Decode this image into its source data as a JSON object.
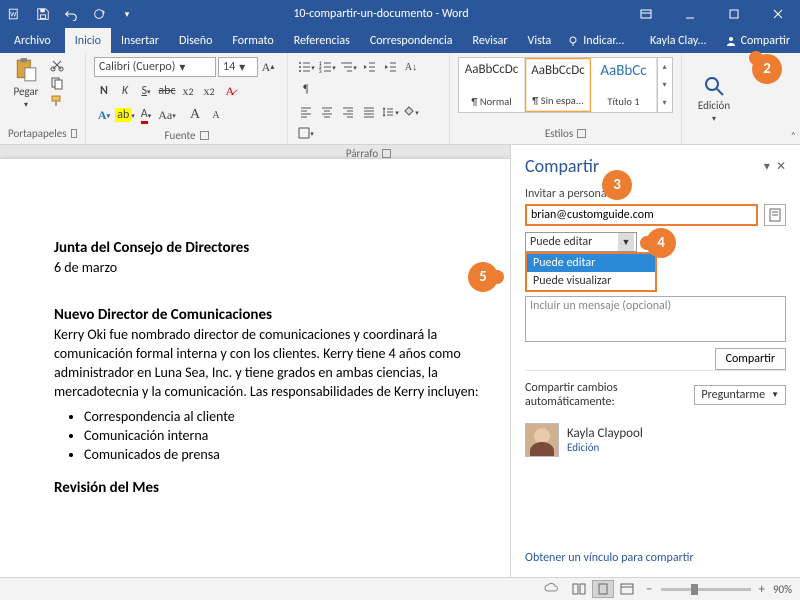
{
  "title": "10-compartir-un-documento - Word",
  "tabs": {
    "file": "Archivo",
    "items": [
      "Inicio",
      "Insertar",
      "Diseño",
      "Formato",
      "Referencias",
      "Correspondencia",
      "Revisar",
      "Vista"
    ],
    "tellme": "Indicar...",
    "account": "Kayla Clay...",
    "share": "Compartir"
  },
  "ribbon": {
    "clipboard": {
      "paste": "Pegar",
      "label": "Portapapeles"
    },
    "font": {
      "name": "Calibri (Cuerpo)",
      "size": "14",
      "label": "Fuente"
    },
    "paragraph": {
      "label": "Párrafo"
    },
    "styles": {
      "label": "Estilos",
      "sample": "AaBbCcDc",
      "sampleH": "AaBbCc",
      "s1": "¶ Normal",
      "s2": "¶ Sin espa...",
      "s3": "Título 1"
    },
    "editing": {
      "label": "Edición"
    }
  },
  "doc": {
    "h1": "Junta del Consejo de Directores",
    "date": "6 de marzo",
    "h2": "Nuevo Director de Comunicaciones",
    "p1": "Kerry Oki fue nombrado director de comunicaciones y coordinará la comunicación formal interna y con los clientes. Kerry tiene 4 años como administrador en Luna Sea, Inc. y tiene grados en ambas ciencias, la mercadotecnia y la comunicación. Las responsabilidades de Kerry incluyen:",
    "b1": "Correspondencia al cliente",
    "b2": "Comunicación interna",
    "b3": "Comunicados de prensa",
    "h3": "Revisión del Mes"
  },
  "share": {
    "title": "Compartir",
    "invite": "Invitar a personas",
    "email": "brian@customguide.com",
    "perm_selected": "Puede editar",
    "perm_options": [
      "Puede editar",
      "Puede visualizar"
    ],
    "msg_placeholder": "Incluir un mensaje (opcional)",
    "submit": "Compartir",
    "auto_label": "Compartir cambios automáticamente:",
    "auto_value": "Preguntarme",
    "person_name": "Kayla Claypool",
    "person_role": "Edición",
    "getlink": "Obtener un vínculo para compartir"
  },
  "status": {
    "zoom": "90%"
  },
  "callouts": {
    "c2": "2",
    "c3": "3",
    "c4": "4",
    "c5": "5"
  }
}
